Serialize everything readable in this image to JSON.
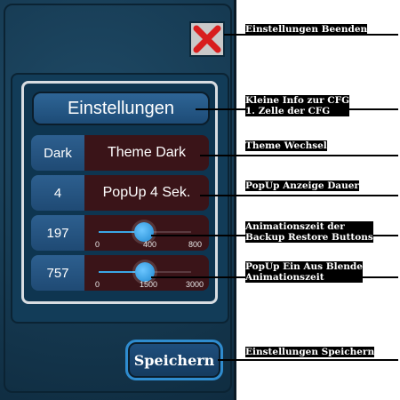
{
  "close": {
    "icon": "close-icon"
  },
  "title_button": {
    "label": "Einstellungen"
  },
  "rows": {
    "theme": {
      "lead": "Dark",
      "value": "Theme  Dark"
    },
    "popup": {
      "lead": "4",
      "value": "PopUp 4 Sek."
    },
    "backup_anim": {
      "lead": "197",
      "min": "0",
      "mid": "400",
      "max": "800",
      "fraction": 0.49
    },
    "popup_anim": {
      "lead": "757",
      "min": "0",
      "mid": "1500",
      "max": "3000",
      "fraction": 0.5
    }
  },
  "save_button": {
    "label": "Speichern"
  },
  "annotations": {
    "close": "Einstellungen Beenden",
    "info": "Kleine Info zur CFG\n1. Zelle der CFG",
    "theme": "Theme Wechsel",
    "popup": "PopUp Anzeige Dauer",
    "backup": "Animationszeit der\nBackup Restore Buttons",
    "popup_anim": "PopUp Ein Aus Blende\nAnimationszeit",
    "save": "Einstellungen Speichern"
  },
  "colors": {
    "panel": "#163a52",
    "row_lead": "#2d5f8f",
    "row_body": "#3a1418",
    "slider_accent": "#3aa6e6",
    "save_border": "#2f8ccf"
  }
}
